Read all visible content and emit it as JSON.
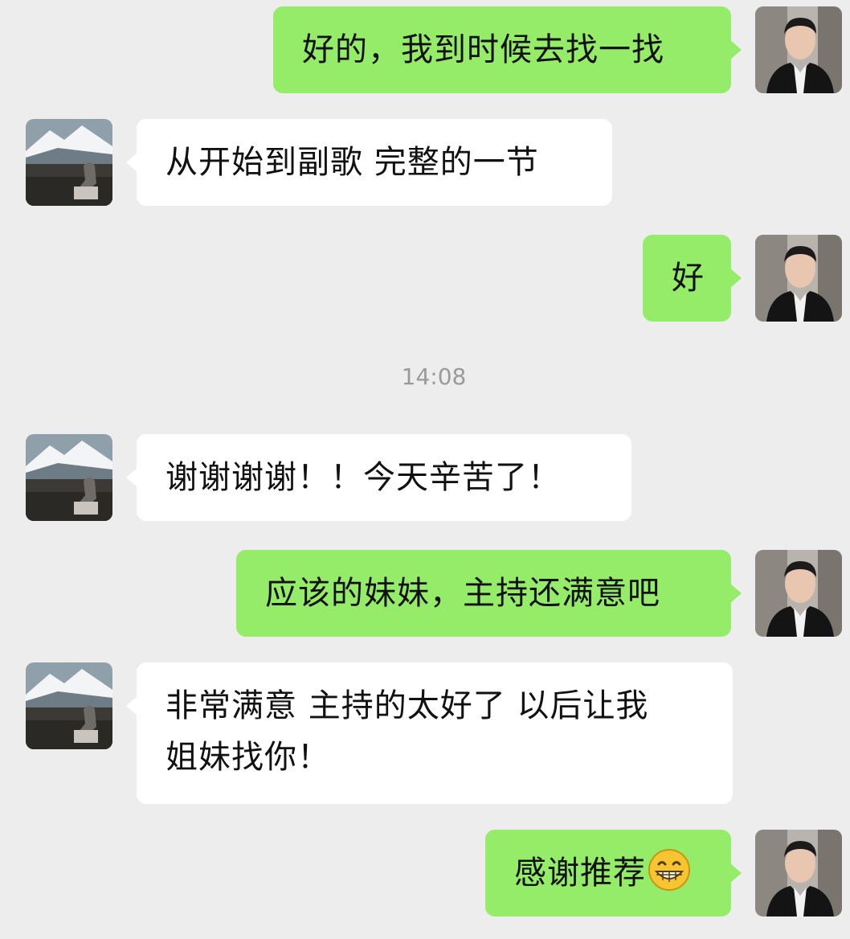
{
  "timestamp": "14:08",
  "messages": [
    {
      "sender": "me",
      "text": "好的，我到时候去找一找"
    },
    {
      "sender": "them",
      "text": "从开始到副歌  完整的一节"
    },
    {
      "sender": "me",
      "text": "好"
    },
    {
      "sender": "them",
      "text": "谢谢谢谢！！今天辛苦了！"
    },
    {
      "sender": "me",
      "text": "应该的妹妹，主持还满意吧"
    },
    {
      "sender": "them",
      "text_line1": "非常满意  主持的太好了  以后让我",
      "text_line2": "姐妹找你！"
    },
    {
      "sender": "me",
      "text": "感谢推荐",
      "emoji": "grinning-face-emoji"
    }
  ],
  "colors": {
    "background": "#ededed",
    "my_bubble": "#95ec69",
    "their_bubble": "#ffffff",
    "timestamp_text": "#9a9a9a"
  },
  "avatars": {
    "me": "man-in-suit-avatar",
    "them": "mountain-landscape-avatar"
  }
}
